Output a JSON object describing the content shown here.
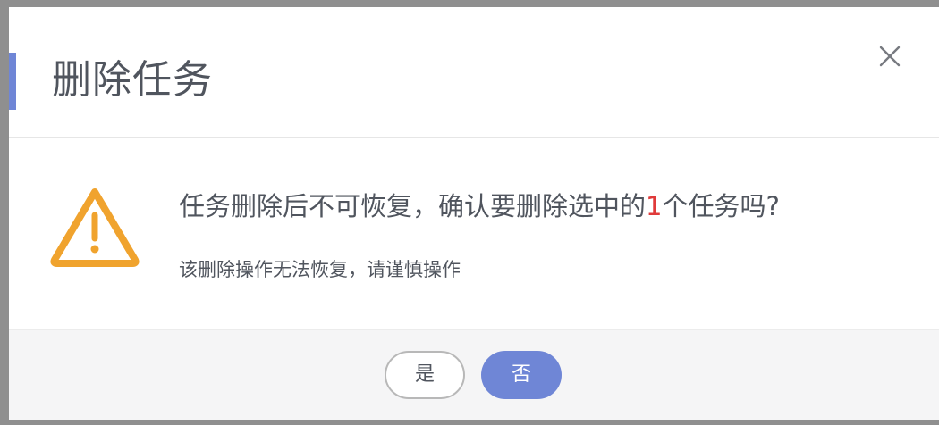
{
  "dialog": {
    "title": "删除任务",
    "close_icon": "close-icon",
    "accent_color": "#6f86d6",
    "warning_icon": "warning-triangle-icon",
    "warning_color": "#f0a32e",
    "message_before": "任务删除后不可恢复，确认要删除选中的",
    "message_count": "1",
    "message_after": "个任务吗?",
    "count_color": "#e03a3a",
    "submessage": "该删除操作无法恢复，请谨慎操作"
  },
  "footer": {
    "yes_label": "是",
    "no_label": "否"
  }
}
